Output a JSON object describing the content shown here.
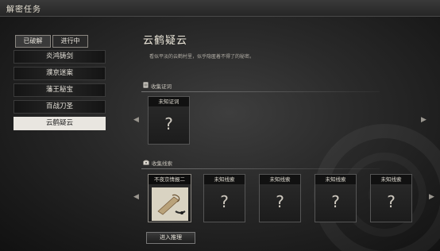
{
  "window": {
    "title": "解密任务"
  },
  "tabs": [
    {
      "label": "已破解"
    },
    {
      "label": "进行中"
    }
  ],
  "tasks": [
    {
      "label": "炎鸿铸剑"
    },
    {
      "label": "濮京迷案"
    },
    {
      "label": "藩王秘宝"
    },
    {
      "label": "百战刀圣"
    },
    {
      "label": "云鹤疑云"
    }
  ],
  "active_task_index": 4,
  "detail": {
    "title": "云鹤疑云",
    "description": "看似平淡的云鹤村里，似乎隐匿着不得了的秘密。"
  },
  "sections": {
    "keywords": {
      "label": "收集证词",
      "cards": [
        {
          "label": "未知证词",
          "mark": "?"
        }
      ]
    },
    "clues": {
      "label": "收集线索",
      "cards": [
        {
          "label": "不夜京情报二",
          "image": "scroll-item"
        },
        {
          "label": "未知线索",
          "mark": "?"
        },
        {
          "label": "未知线索",
          "mark": "?"
        },
        {
          "label": "未知线索",
          "mark": "?"
        },
        {
          "label": "未知线索",
          "mark": "?"
        }
      ]
    }
  },
  "actions": {
    "infer_label": "进入推理"
  },
  "icons": {
    "prev": "left-arrow-icon",
    "next": "right-arrow-icon",
    "keyword_section": "document-icon",
    "clue_section": "chest-icon"
  }
}
